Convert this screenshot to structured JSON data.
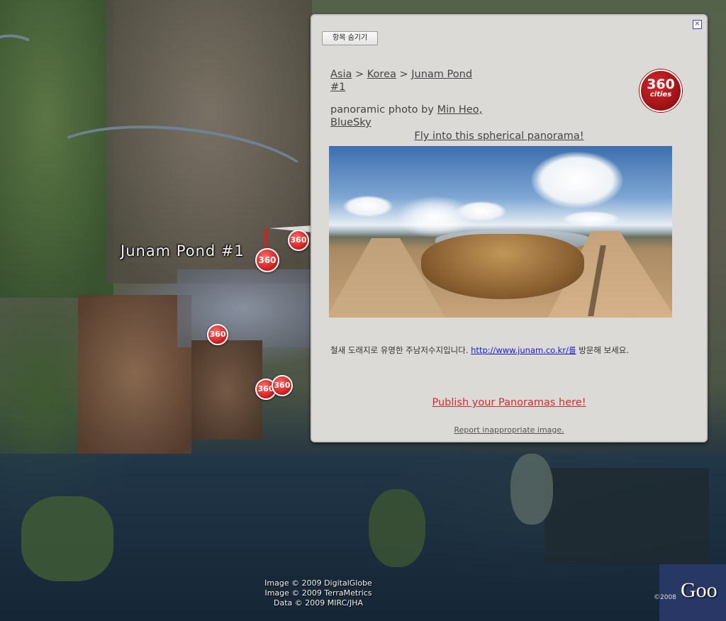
{
  "map": {
    "place_label": "Junam Pond #1",
    "marker_text": "360",
    "copyright_lines": [
      "Image © 2009 DigitalGlobe",
      "Image © 2009 TerraMetrics",
      "Data © 2009 MIRC/JHA"
    ],
    "google_logo": "Goo",
    "google_year": "©2008"
  },
  "balloon": {
    "close_symbol": "×",
    "hide_button_label": "항목 숨기기",
    "breadcrumb": {
      "asia": "Asia",
      "sep": ">",
      "korea": "Korea",
      "junam": "Junam Pond",
      "junam_suffix": "#1"
    },
    "byline_prefix": "panoramic photo by",
    "author_line1": "Min Heo,",
    "author_line2": "BlueSky",
    "logo_number": "360",
    "logo_word": "cities",
    "fly_link": "Fly into this spherical panorama!",
    "description_before": "철새 도래지로 유명한 주남저수지입니다.",
    "description_link": "http://www.junam.co.kr/를",
    "description_after": "방문해 보세요.",
    "publish_link": "Publish your Panoramas here!",
    "report_link": "Report inappropriate image."
  }
}
